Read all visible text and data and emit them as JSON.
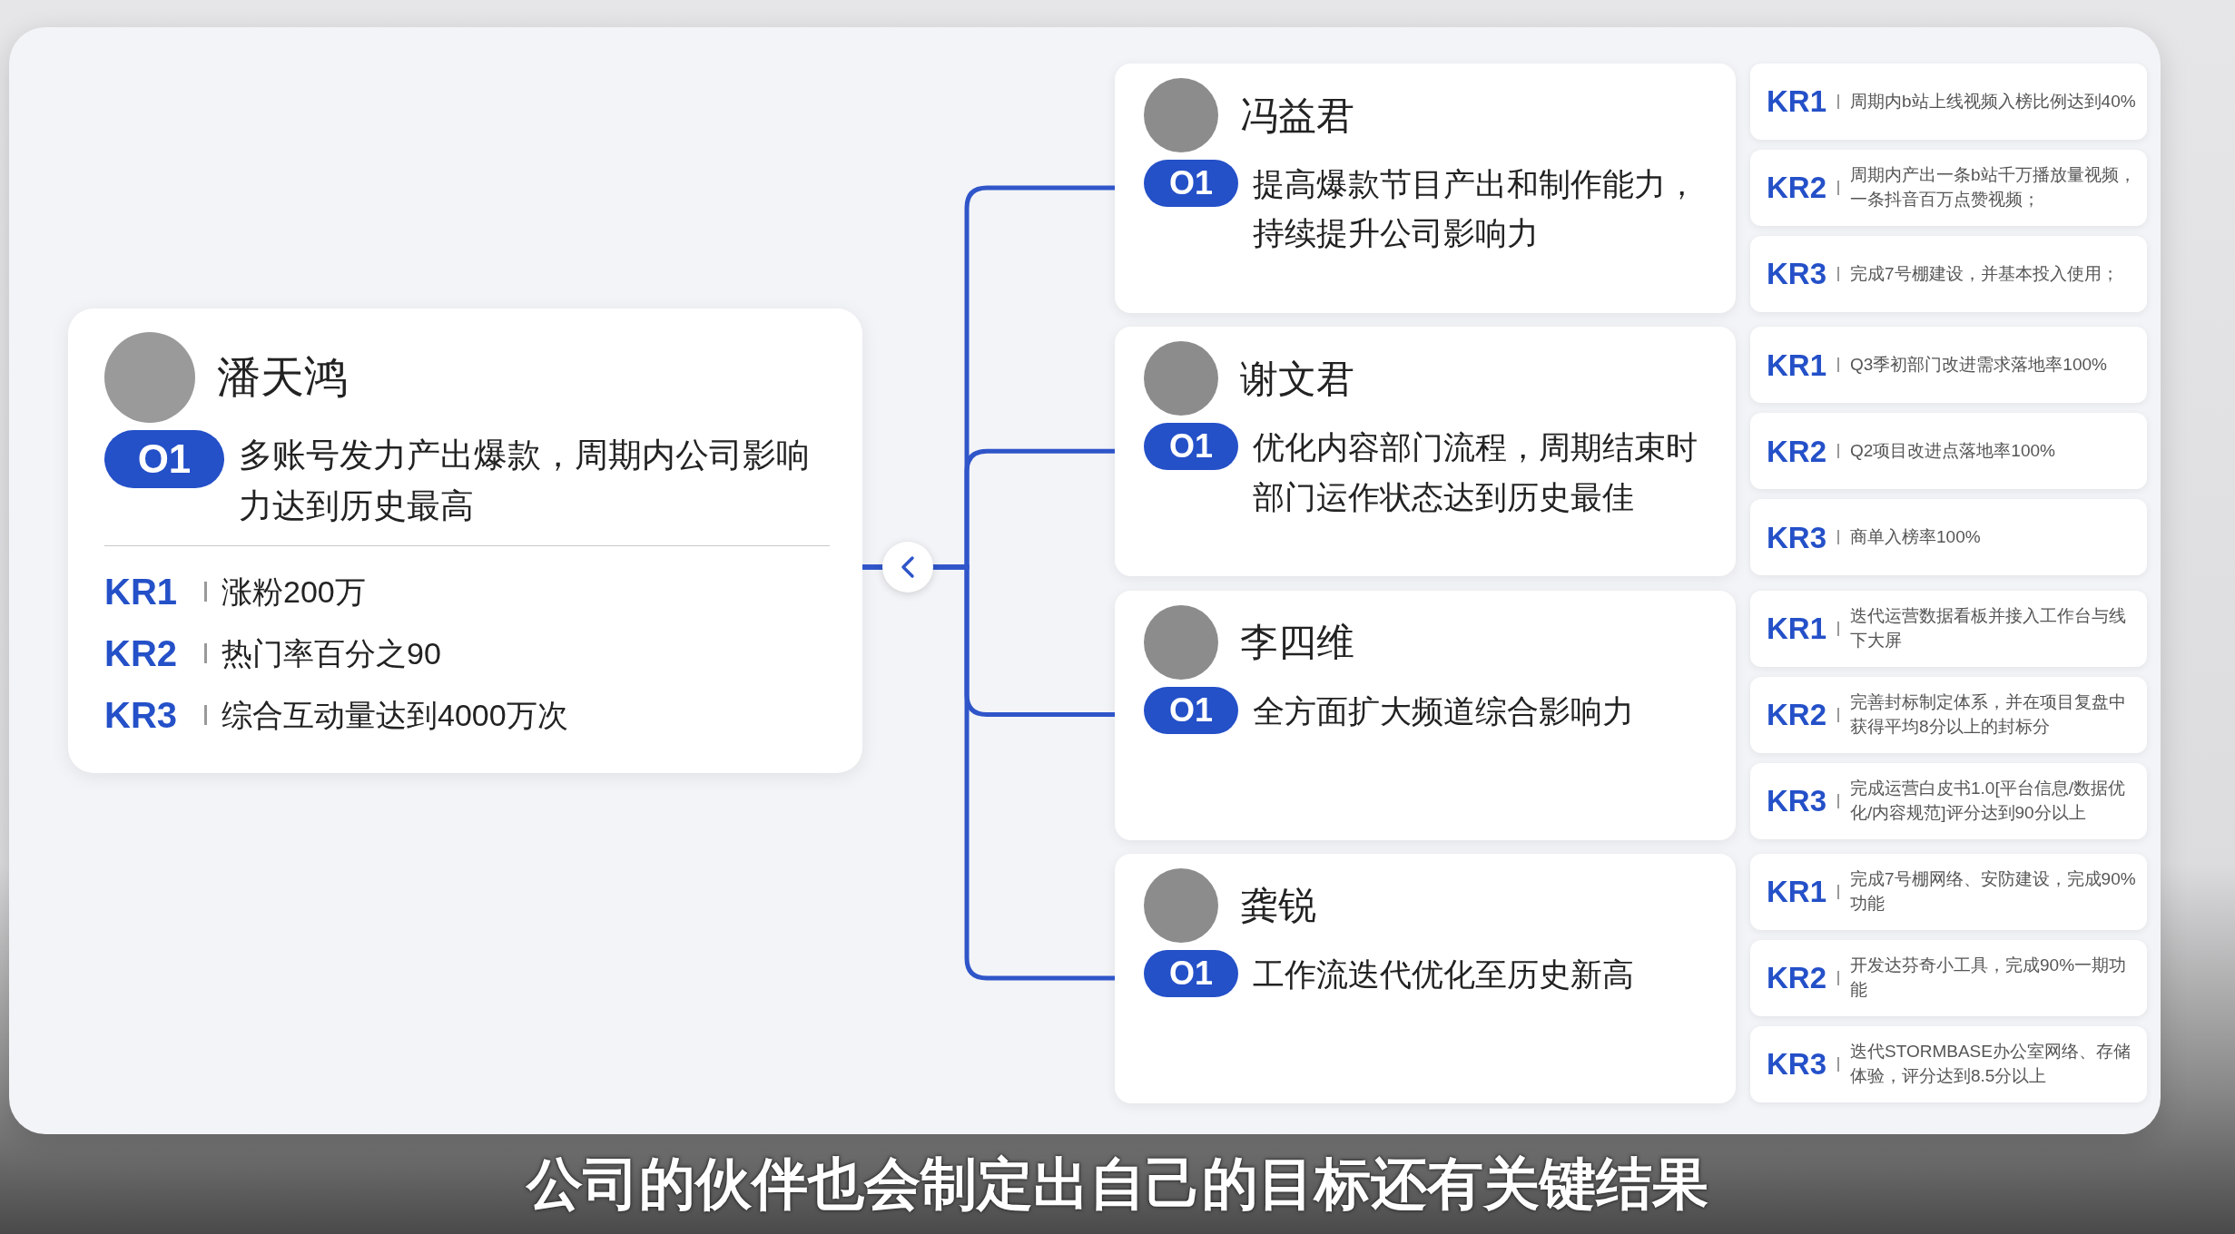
{
  "main": {
    "name": "潘天鸿",
    "objective": {
      "badge": "O1",
      "text": "多账号发力产出爆款，周期内公司影响力达到历史最高"
    },
    "key_results": [
      {
        "label": "KR1",
        "text": "涨粉200万"
      },
      {
        "label": "KR2",
        "text": "热门率百分之90"
      },
      {
        "label": "KR3",
        "text": "综合互动量达到4000万次"
      }
    ]
  },
  "members": [
    {
      "name": "冯益君",
      "objective": {
        "badge": "O1",
        "text": "提高爆款节目产出和制作能力，持续提升公司影响力"
      },
      "key_results": [
        {
          "label": "KR1",
          "text": "周期内b站上线视频入榜比例达到40%"
        },
        {
          "label": "KR2",
          "text": "周期内产出一条b站千万播放量视频，一条抖音百万点赞视频；"
        },
        {
          "label": "KR3",
          "text": "完成7号棚建设，并基本投入使用；"
        }
      ]
    },
    {
      "name": "谢文君",
      "objective": {
        "badge": "O1",
        "text": "优化内容部门流程，周期结束时部门运作状态达到历史最佳"
      },
      "key_results": [
        {
          "label": "KR1",
          "text": "Q3季初部门改进需求落地率100%"
        },
        {
          "label": "KR2",
          "text": "Q2项目改进点落地率100%"
        },
        {
          "label": "KR3",
          "text": "商单入榜率100%"
        }
      ]
    },
    {
      "name": "李四维",
      "objective": {
        "badge": "O1",
        "text": "全方面扩大频道综合影响力"
      },
      "key_results": [
        {
          "label": "KR1",
          "text": "迭代运营数据看板并接入工作台与线下大屏"
        },
        {
          "label": "KR2",
          "text": "完善封标制定体系，并在项目复盘中获得平均8分以上的封标分"
        },
        {
          "label": "KR3",
          "text": "完成运营白皮书1.0[平台信息/数据优化/内容规范]评分达到90分以上"
        }
      ]
    },
    {
      "name": "龚锐",
      "objective": {
        "badge": "O1",
        "text": "工作流迭代优化至历史新高"
      },
      "key_results": [
        {
          "label": "KR1",
          "text": "完成7号棚网络、安防建设，完成90%功能"
        },
        {
          "label": "KR2",
          "text": "开发达芬奇小工具，完成90%一期功能"
        },
        {
          "label": "KR3",
          "text": "迭代STORMBASE办公室网络、存储体验，评分达到8.5分以上"
        }
      ]
    }
  ],
  "subtitle": "公司的伙伴也会制定出自己的目标还有关键结果"
}
